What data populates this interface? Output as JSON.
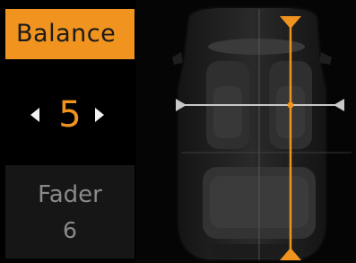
{
  "balance_tab": {
    "label": "Balance"
  },
  "balance_stepper": {
    "value": "5",
    "left_icon": "chevron-left-icon",
    "right_icon": "chevron-right-icon"
  },
  "fader_tab": {
    "label": "Fader",
    "value": "6"
  },
  "colors": {
    "accent": "#f0931f",
    "slider_line": "#c8c8c8",
    "background": "#050505"
  }
}
